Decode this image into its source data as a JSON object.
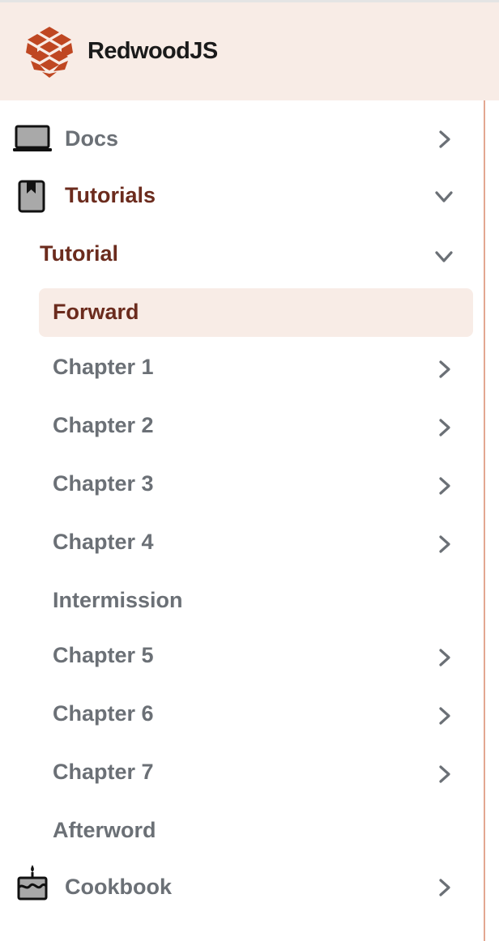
{
  "header": {
    "brand": "RedwoodJS",
    "brand_color": "#1a1a1a",
    "logo_icon": "redwood-logo-icon",
    "background": "#f8ece6"
  },
  "sidebar": {
    "accent_color": "#6b2b1d",
    "muted_color": "#6b7076",
    "border_color": "#e3a791",
    "top_items": [
      {
        "label": "Docs",
        "icon": "laptop-icon",
        "chevron": "right"
      },
      {
        "label": "Tutorials",
        "icon": "book-icon",
        "chevron": "down",
        "active": true
      }
    ],
    "section": {
      "label": "Tutorial",
      "chevron": "down",
      "active": true
    },
    "sub_items": [
      {
        "label": "Forward",
        "selected": true
      },
      {
        "label": "Chapter 1",
        "chevron": "right"
      },
      {
        "label": "Chapter 2",
        "chevron": "right"
      },
      {
        "label": "Chapter 3",
        "chevron": "right"
      },
      {
        "label": "Chapter 4",
        "chevron": "right"
      },
      {
        "label": "Intermission"
      },
      {
        "label": "Chapter 5",
        "chevron": "right"
      },
      {
        "label": "Chapter 6",
        "chevron": "right"
      },
      {
        "label": "Chapter 7",
        "chevron": "right"
      },
      {
        "label": "Afterword"
      }
    ],
    "bottom_items": [
      {
        "label": "Cookbook",
        "icon": "cake-icon",
        "chevron": "right"
      }
    ]
  }
}
